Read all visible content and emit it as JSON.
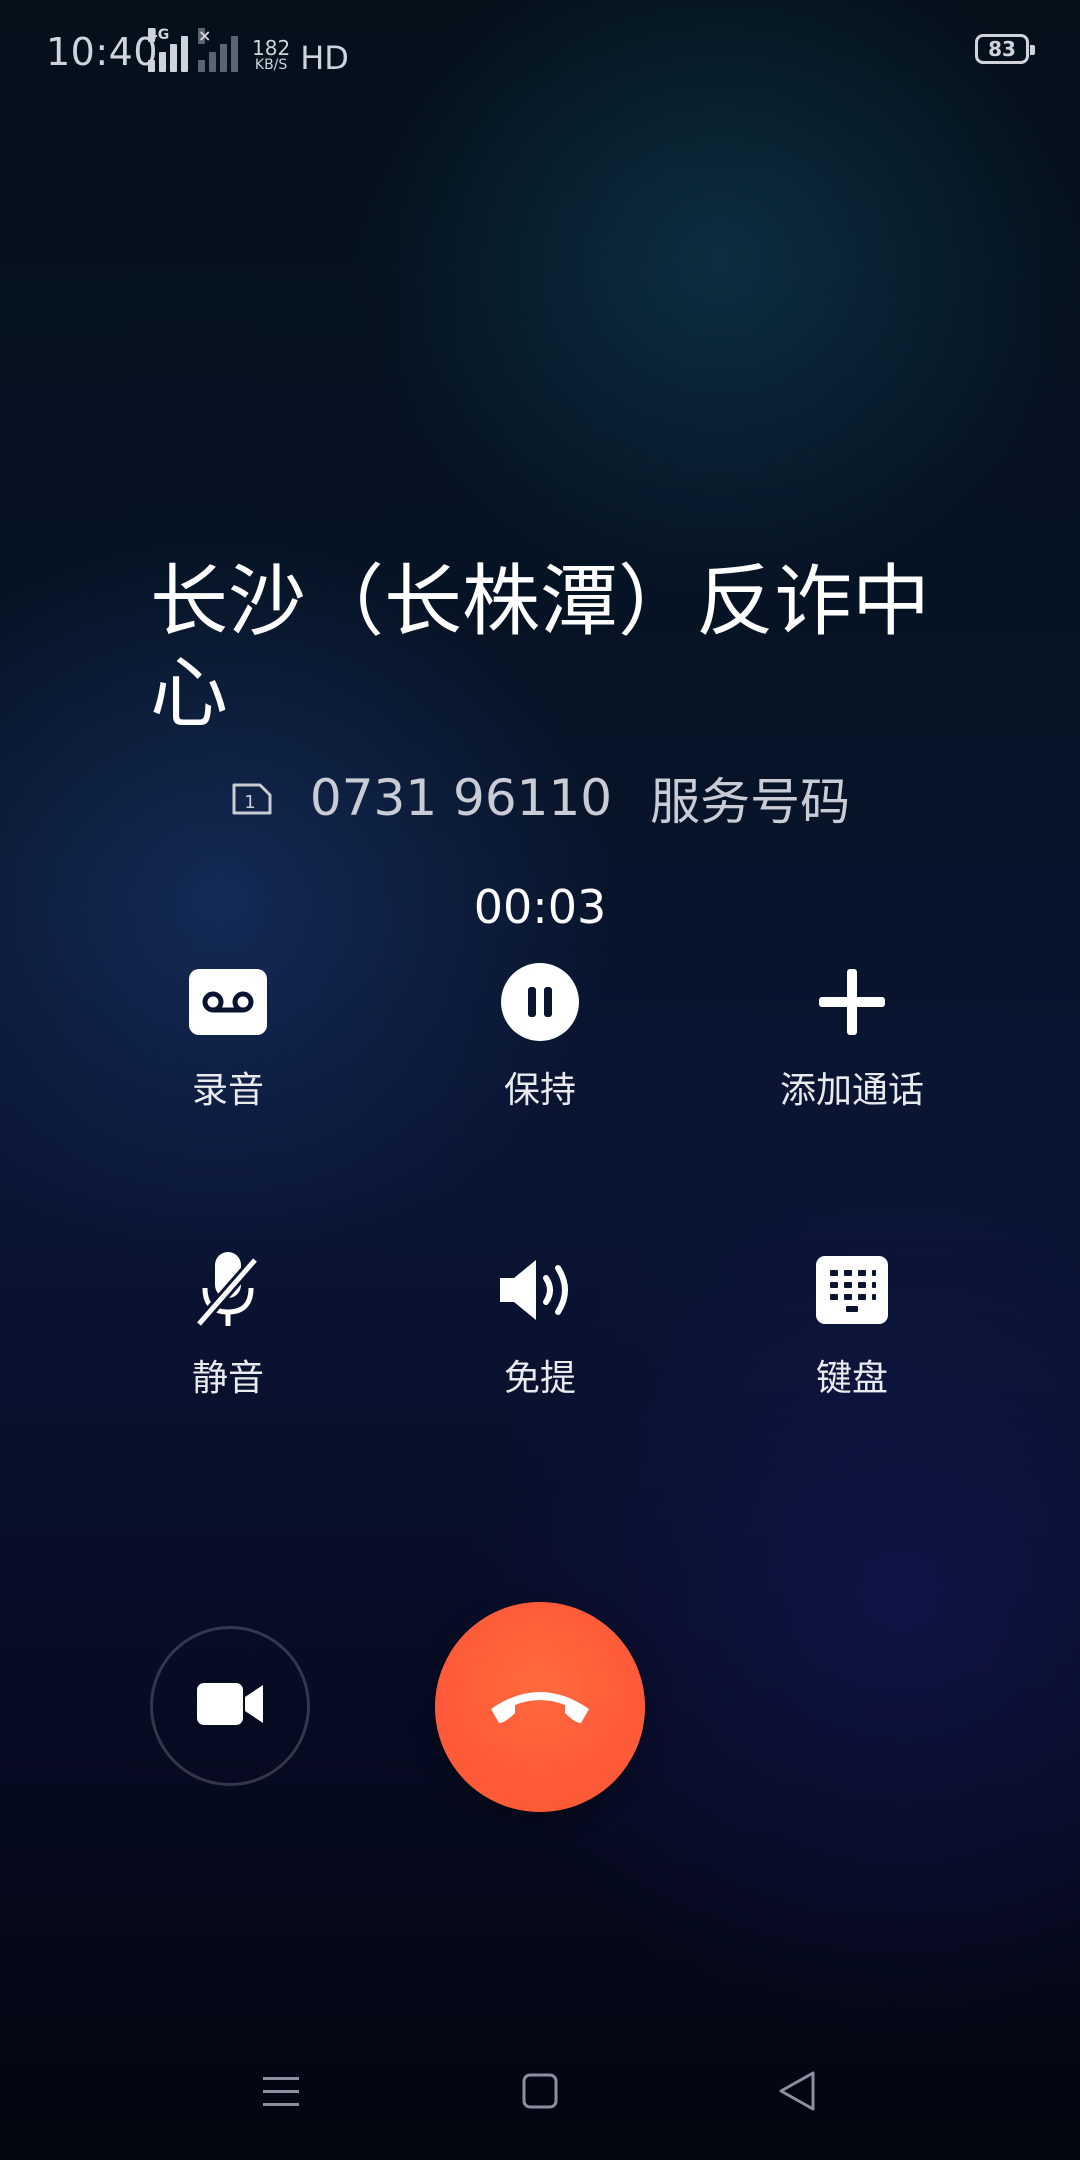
{
  "status_bar": {
    "time": "10:40",
    "network_type": "4G",
    "speed_value": "182",
    "speed_unit": "KB/S",
    "hd_label": "HD",
    "battery_level": "83"
  },
  "caller": {
    "name": "长沙（长株潭）反诈中心",
    "sim_slot": "1",
    "number": "0731 96110",
    "label": "服务号码"
  },
  "call": {
    "duration": "00:03"
  },
  "actions": {
    "record": "录音",
    "hold": "保持",
    "add_call": "添加通话",
    "mute": "静音",
    "speaker": "免提",
    "keypad": "键盘"
  },
  "icons": {
    "record": "voicemail-icon",
    "hold": "pause-icon",
    "add_call": "plus-icon",
    "mute": "mic-off-icon",
    "speaker": "speaker-icon",
    "keypad": "dialpad-icon",
    "video": "video-camera-icon",
    "end_call": "phone-hangup-icon"
  },
  "colors": {
    "end_call": "#ff5d3a",
    "text_secondary": "#c9ccd4"
  }
}
